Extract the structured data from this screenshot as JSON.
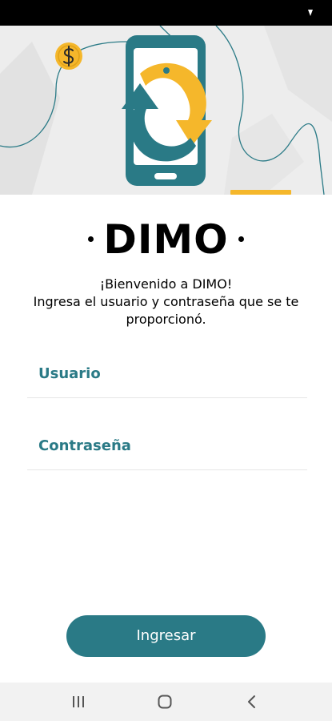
{
  "header": {
    "brand": "DIMO"
  },
  "welcome": {
    "line1": "¡Bienvenido a DIMO!",
    "line2": "Ingresa el usuario y contraseña que se te proporcionó."
  },
  "form": {
    "username_placeholder": "Usuario",
    "password_placeholder": "Contraseña",
    "submit_label": "Ingresar"
  },
  "icons": {
    "hero": "phone-sync-arrows-illustration",
    "coin": "dollar-coin-icon",
    "nav_recent": "recent-apps-icon",
    "nav_home": "home-icon",
    "nav_back": "back-icon"
  },
  "colors": {
    "primary": "#2a7a86",
    "accent": "#f5b72b",
    "hero_bg": "#ededed",
    "text": "#000000"
  }
}
